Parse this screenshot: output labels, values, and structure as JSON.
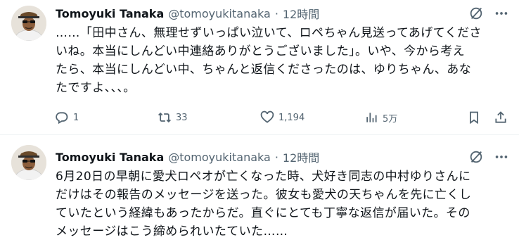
{
  "tweets": [
    {
      "author_name": "Tomoyuki Tanaka",
      "handle": "@tomoyukitanaka",
      "separator": "·",
      "time": "12時間",
      "lines": [
        "……「田中さん、無理せずいっぱい泣いて、ロペちゃん見送ってあげてくださ",
        "いね。本当にしんどい中連絡ありがとうございました」。いや、今から考え",
        "たら、本当にしんどい中、ちゃんと返信くださったのは、ゆりちゃん、あな",
        "たですよ、、、。"
      ],
      "replies": "1",
      "reposts": "33",
      "likes": "1,194",
      "views": "5万"
    },
    {
      "author_name": "Tomoyuki Tanaka",
      "handle": "@tomoyukitanaka",
      "separator": "·",
      "time": "12時間",
      "lines": [
        "6月20日の早朝に愛犬ロペオが亡くなった時、犬好き同志の中村ゆりさんに",
        "だけはその報告のメッセージを送った。彼女も愛犬の天ちゃんを先に亡くし",
        "ていたという経緯もあったからだ。直ぐにとても丁寧な返信が届いた。その",
        "メッセージはこう締められいたていた……"
      ]
    }
  ],
  "icons": {
    "more": "more-horizontal-icon",
    "grok": "grok-icon",
    "reply": "reply-icon",
    "repost": "repost-icon",
    "like": "heart-icon",
    "views": "views-bar-chart-icon",
    "bookmark": "bookmark-icon",
    "share": "share-icon"
  },
  "colors": {
    "text": "#0f1419",
    "secondary": "#536471",
    "divider": "#eff3f4"
  }
}
